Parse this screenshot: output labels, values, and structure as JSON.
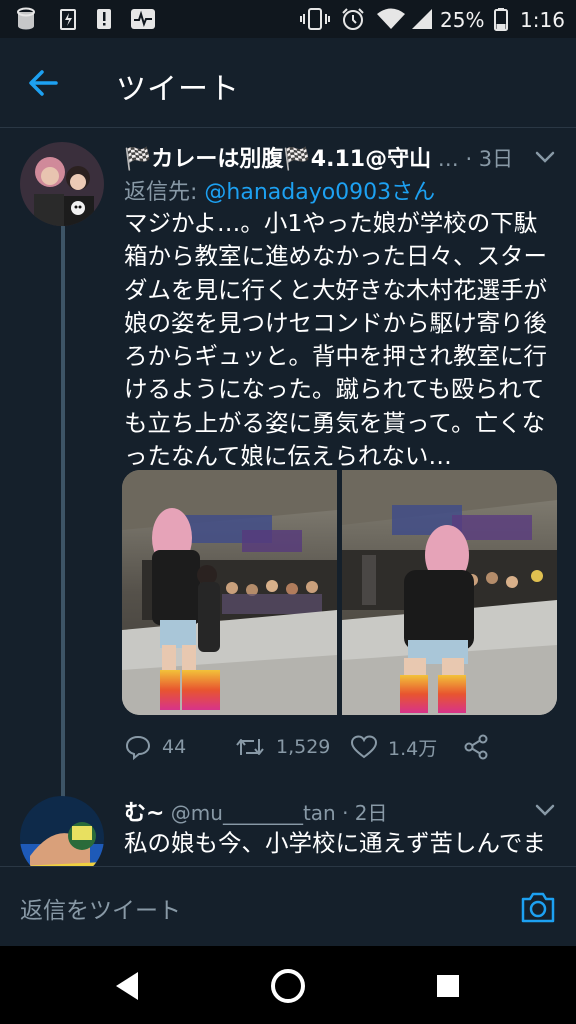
{
  "status_bar": {
    "battery_percent": "25%",
    "time": "1:16",
    "icons": [
      "sim-icon",
      "no-flash-icon",
      "alert-icon",
      "activity-icon",
      "vibrate-icon",
      "alarm-icon",
      "wifi-icon",
      "signal-icon",
      "battery-icon"
    ]
  },
  "header": {
    "back_icon": "arrow-left-icon",
    "title": "ツイート"
  },
  "tweet": {
    "author_name": "🏁カレーは別腹🏁4.11@守山",
    "ellipsis": " …",
    "time": " · 3日",
    "reply_prefix": "返信先: ",
    "reply_handle": "@hanadayo0903さん",
    "text_lines": [
      "マジかよ…。小1やった娘が学校の下駄",
      "箱から教室に進めなかった日々、スター",
      "ダムを見に行くと大好きな木村花選手が",
      "娘の姿を見つけセコンドから駆け寄り後",
      "ろからギュッと。背中を押され教室に行",
      "けるようになった。蹴られても殴られて",
      "も立ち上がる姿に勇気を貰って。亡くな",
      "ったなんて娘に伝えられない…"
    ],
    "replies": "44",
    "retweets": "1,529",
    "likes": "1.4万"
  },
  "reply_tweet": {
    "author_name": "む~",
    "handle": " @mu________tan",
    "time": " · 2日",
    "text": "私の娘も今、小学校に通えず苦しんでま"
  },
  "reply_bar": {
    "placeholder": "返信をツイート",
    "camera_icon": "camera-icon"
  },
  "nav": {
    "icons": [
      "back-triangle-icon",
      "home-circle-icon",
      "recents-square-icon"
    ]
  },
  "colors": {
    "background": "#15202b",
    "accent": "#1da1f2",
    "muted": "#8899a6",
    "divider": "#2a3744"
  }
}
